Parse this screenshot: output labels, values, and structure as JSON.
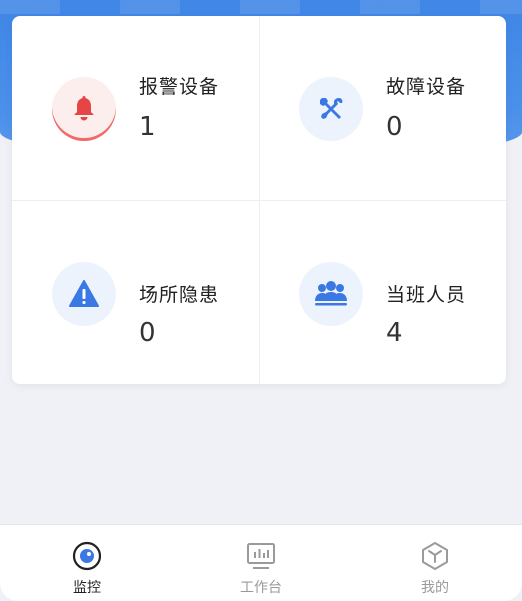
{
  "colors": {
    "accent": "#3a78e4",
    "alarm": "#e64545",
    "background": "#eff1f6",
    "header": "#4b90ea"
  },
  "stats": [
    {
      "label": "报警设备",
      "value": "1",
      "icon": "bell-icon"
    },
    {
      "label": "故障设备",
      "value": "0",
      "icon": "tools-icon"
    },
    {
      "label": "场所隐患",
      "value": "0",
      "icon": "warning-icon"
    },
    {
      "label": "当班人员",
      "value": "4",
      "icon": "people-icon"
    }
  ],
  "tabbar": {
    "items": [
      {
        "label": "监控",
        "icon": "monitor-icon",
        "active": true
      },
      {
        "label": "工作台",
        "icon": "workbench-icon",
        "active": false
      },
      {
        "label": "我的",
        "icon": "profile-icon",
        "active": false
      }
    ]
  }
}
